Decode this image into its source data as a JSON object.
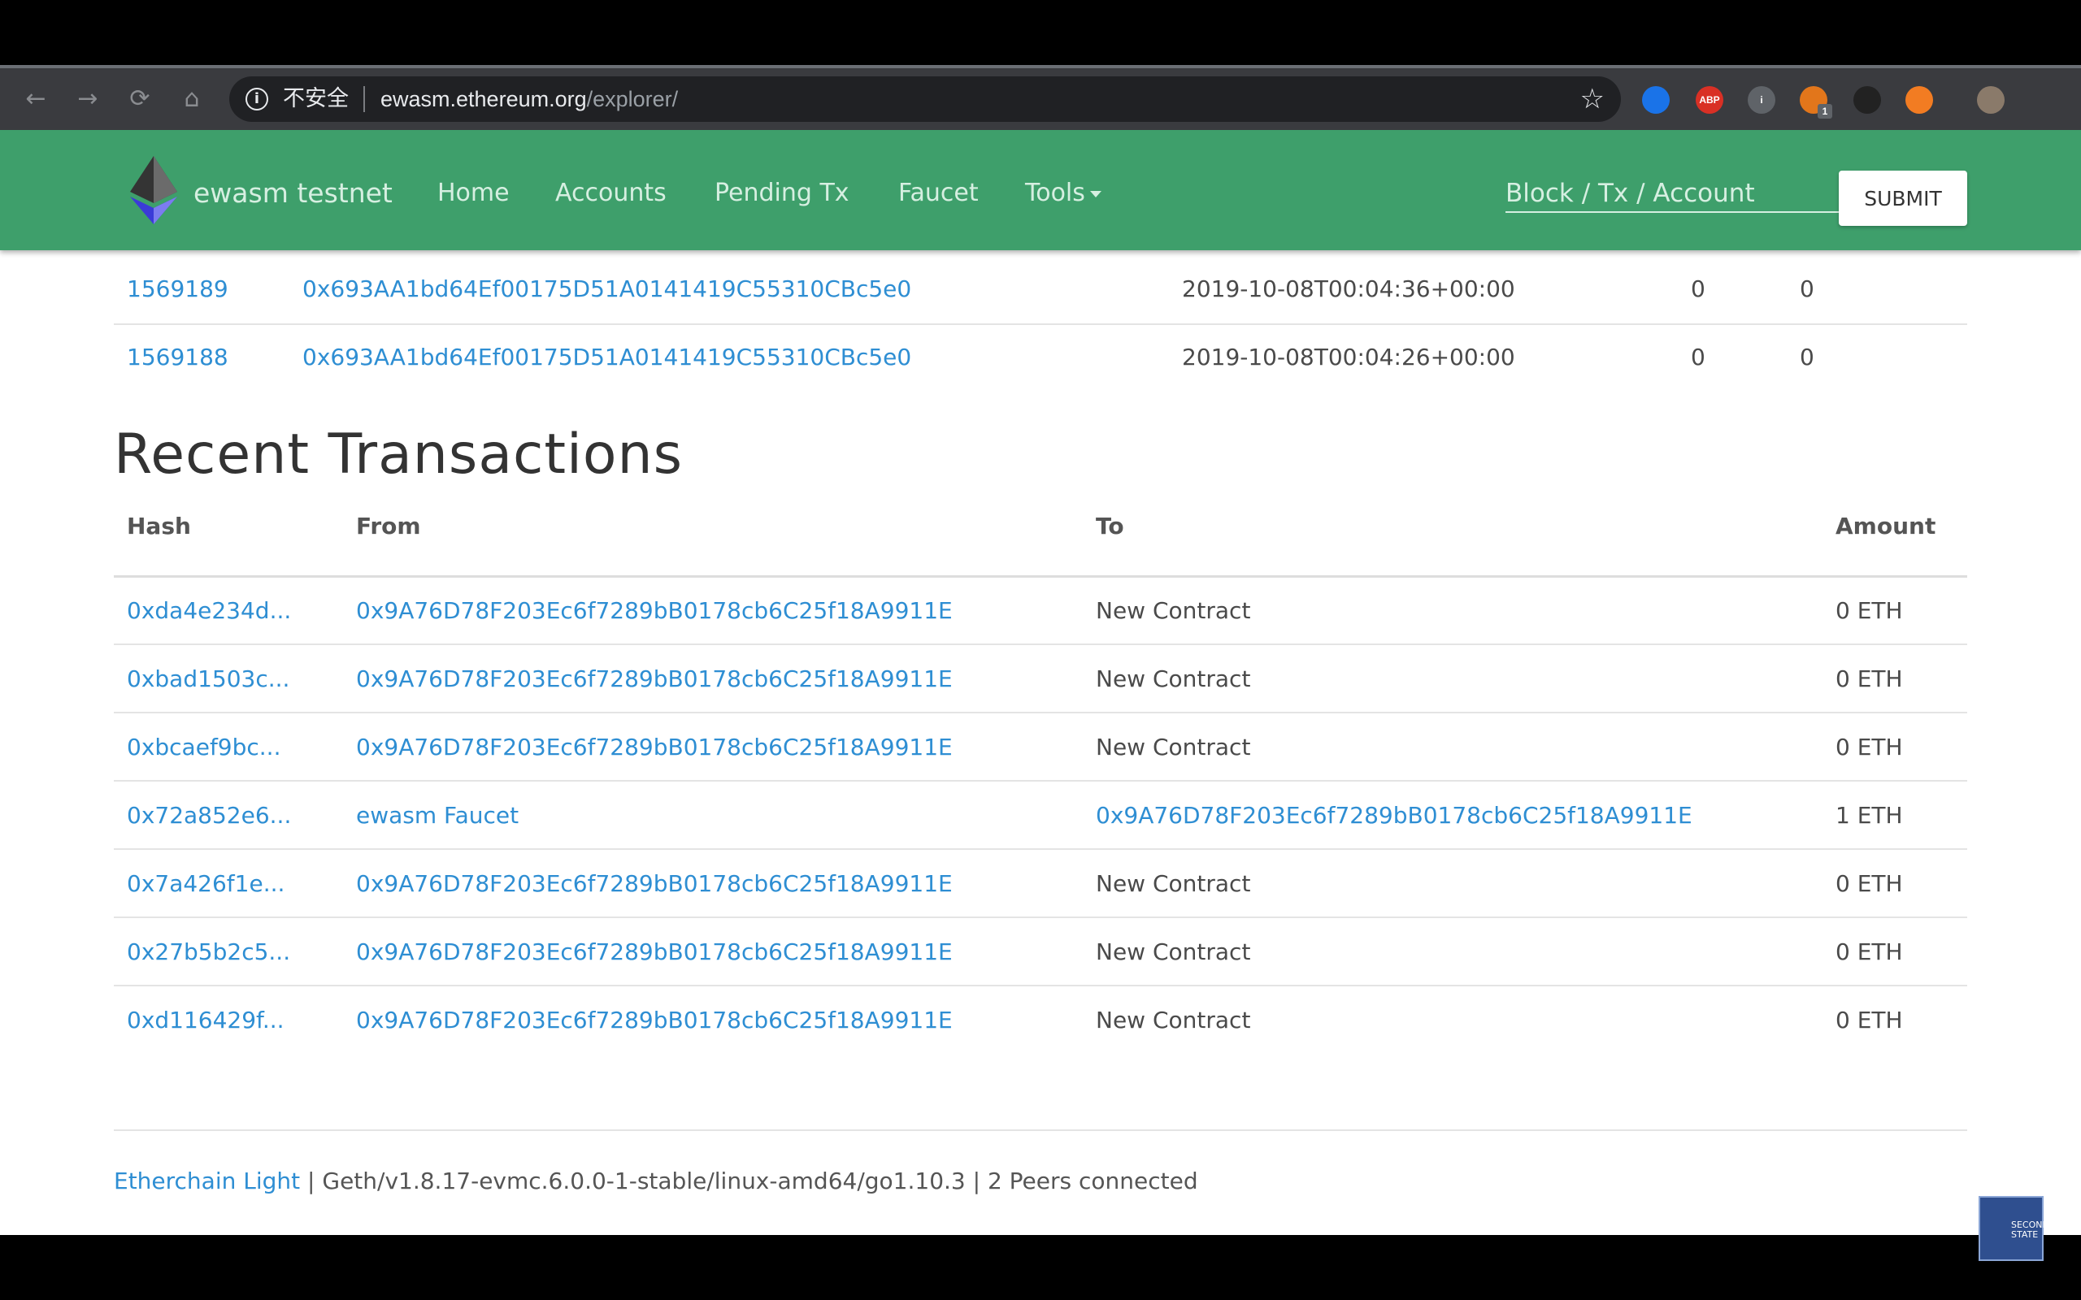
{
  "browser": {
    "security_label": "不安全",
    "url_host": "ewasm.ethereum.org",
    "url_path": "/explorer/",
    "nav": {
      "back": "←",
      "forward": "→",
      "reload": "⟳",
      "home": "⌂"
    },
    "star_icon": "☆",
    "extensions": [
      {
        "name": "diamond-extension-icon",
        "label": "",
        "color": "#1a73e8"
      },
      {
        "name": "adblock-plus-icon",
        "label": "ABP",
        "color": "#d93025"
      },
      {
        "name": "info-extension-icon",
        "label": "i",
        "color": "#5f6368"
      },
      {
        "name": "metamask-fox-icon",
        "label": "",
        "color": "#e2761b",
        "badge": "1"
      },
      {
        "name": "hexagon-extension-icon",
        "label": "",
        "color": "#222"
      },
      {
        "name": "brave-lion-icon",
        "label": "",
        "color": "#f27c22"
      },
      {
        "name": "profile-avatar-icon",
        "label": "",
        "color": "#8a7a6a"
      }
    ]
  },
  "navbar": {
    "brand": "ewasm testnet",
    "links": [
      "Home",
      "Accounts",
      "Pending Tx",
      "Faucet",
      "Tools"
    ],
    "search_placeholder": "Block / Tx / Account",
    "submit_label": "SUBMIT"
  },
  "blocks": [
    {
      "number": "1569189",
      "miner": "0x693AA1bd64Ef00175D51A0141419C55310CBc5e0",
      "time": "2019-10-08T00:04:36+00:00",
      "c1": "0",
      "c2": "0"
    },
    {
      "number": "1569188",
      "miner": "0x693AA1bd64Ef00175D51A0141419C55310CBc5e0",
      "time": "2019-10-08T00:04:26+00:00",
      "c1": "0",
      "c2": "0"
    }
  ],
  "transactions": {
    "title": "Recent Transactions",
    "headers": {
      "hash": "Hash",
      "from": "From",
      "to": "To",
      "amount": "Amount"
    },
    "rows": [
      {
        "hash": "0xda4e234d...",
        "from": "0x9A76D78F203Ec6f7289bB0178cb6C25f18A9911E",
        "to": "New Contract",
        "to_link": false,
        "amount": "0 ETH"
      },
      {
        "hash": "0xbad1503c...",
        "from": "0x9A76D78F203Ec6f7289bB0178cb6C25f18A9911E",
        "to": "New Contract",
        "to_link": false,
        "amount": "0 ETH"
      },
      {
        "hash": "0xbcaef9bc...",
        "from": "0x9A76D78F203Ec6f7289bB0178cb6C25f18A9911E",
        "to": "New Contract",
        "to_link": false,
        "amount": "0 ETH"
      },
      {
        "hash": "0x72a852e6...",
        "from": "ewasm Faucet",
        "to": "0x9A76D78F203Ec6f7289bB0178cb6C25f18A9911E",
        "to_link": true,
        "amount": "1 ETH"
      },
      {
        "hash": "0x7a426f1e...",
        "from": "0x9A76D78F203Ec6f7289bB0178cb6C25f18A9911E",
        "to": "New Contract",
        "to_link": false,
        "amount": "0 ETH"
      },
      {
        "hash": "0x27b5b2c5...",
        "from": "0x9A76D78F203Ec6f7289bB0178cb6C25f18A9911E",
        "to": "New Contract",
        "to_link": false,
        "amount": "0 ETH"
      },
      {
        "hash": "0xd116429f...",
        "from": "0x9A76D78F203Ec6f7289bB0178cb6C25f18A9911E",
        "to": "New Contract",
        "to_link": false,
        "amount": "0 ETH"
      }
    ]
  },
  "footer": {
    "link": "Etherchain Light",
    "text": " | Geth/v1.8.17-evmc.6.0.0-1-stable/linux-amd64/go1.10.3 | 2 Peers connected"
  },
  "watermark": {
    "text": "SECOND STATE"
  },
  "colors": {
    "navbar": "#3e9f6b",
    "link": "#2e8ed3"
  }
}
